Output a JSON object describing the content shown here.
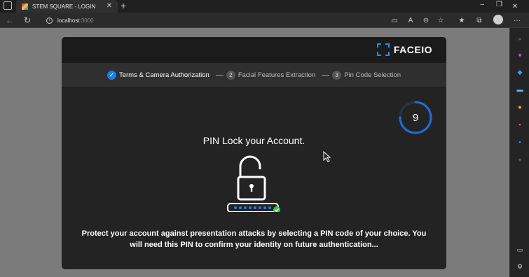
{
  "browser": {
    "tab_title": "STEM SQUARE - LOGIN",
    "tab_close": "✕",
    "new_tab": "+",
    "url_host": "localhost",
    "url_port": ":3000",
    "window_min": "–",
    "window_max": "❐",
    "window_close": "✕",
    "menu": "···"
  },
  "modal": {
    "brand": "FACEIO",
    "steps": [
      {
        "label": "Terms & Camera Authorization",
        "marker": "✓"
      },
      {
        "label": "Facial Features Extraction",
        "marker": "2"
      },
      {
        "label": "Pin Code Selection",
        "marker": "3"
      }
    ],
    "countdown": "9",
    "countdown_progress": 0.75,
    "headline": "PIN Lock your Account.",
    "description": "Protect your account against presentation attacks by selecting a PIN code of your choice. You will need this PIN to confirm your identity on future authentication..."
  },
  "colors": {
    "accent": "#1e90ff",
    "success": "#2ecc40",
    "modal_bg": "#232323"
  }
}
